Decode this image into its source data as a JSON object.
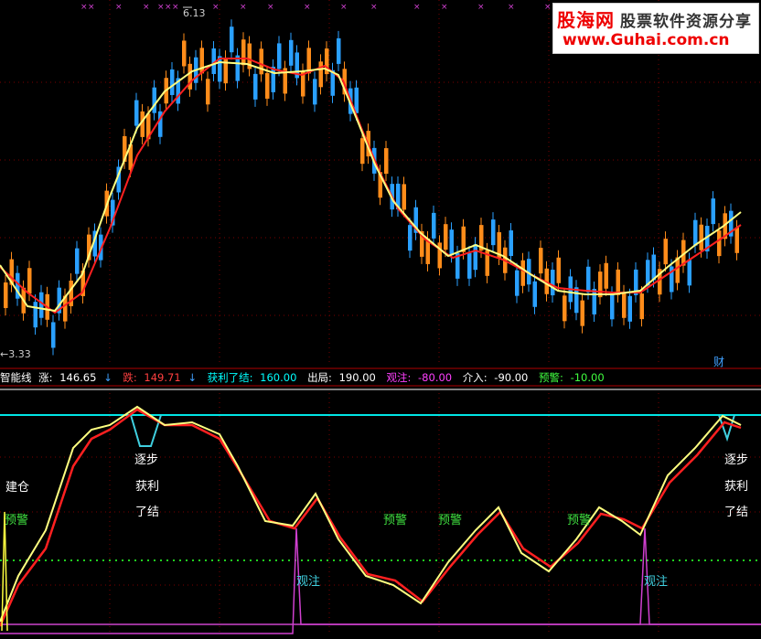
{
  "logo": {
    "brand": "股海网",
    "tagline": "股票软件资源分享",
    "url": "www.Guhai.com.cn"
  },
  "price_panel": {
    "high_marker": "6.13",
    "low_marker": "3.33",
    "event_marker": "财",
    "colors": {
      "up": "#ff8c1a",
      "down": "#2aa0ff",
      "ma_fast": "#ffff80",
      "ma_slow": "#ff2020",
      "grid": "#7a0000"
    }
  },
  "indicator_bar": {
    "name": "智能线",
    "items": [
      {
        "label": "涨:",
        "value": "146.65",
        "arrow": "↓",
        "color": "#ffffff"
      },
      {
        "label": "跌:",
        "value": "149.71",
        "arrow": "↓",
        "color": "#ff4040"
      },
      {
        "label": "获利了结:",
        "value": "160.00",
        "color": "#00ffff"
      },
      {
        "label": "出局:",
        "value": "190.00",
        "color": "#ffffff"
      },
      {
        "label": "观注:",
        "value": "-80.00",
        "color": "#ff40ff"
      },
      {
        "label": "介入:",
        "value": "-90.00",
        "color": "#ffffff"
      },
      {
        "label": "预警:",
        "value": "-10.00",
        "color": "#40ff40"
      }
    ]
  },
  "annotations": {
    "build_position": "建仓",
    "warning": "预警",
    "gradual": "逐步",
    "take_profit": "获利",
    "close_out": "了结",
    "watch": "观注"
  },
  "chart_data": [
    {
      "type": "candlestick",
      "title": "",
      "markers": {
        "high": 6.13,
        "low": 3.33
      },
      "series": [
        {
          "name": "",
          "type": "line",
          "role": "fast moving average"
        },
        {
          "name": "",
          "type": "line",
          "role": "slow moving average"
        }
      ]
    },
    {
      "type": "line",
      "title": "智能线",
      "series": [
        {
          "name": "涨",
          "value": 146.65
        },
        {
          "name": "跌",
          "value": 149.71
        },
        {
          "name": "获利了结",
          "value": 160.0
        },
        {
          "name": "出局",
          "value": 190.0
        },
        {
          "name": "观注",
          "value": -80.0
        },
        {
          "name": "介入",
          "value": -90.0
        },
        {
          "name": "预警",
          "value": -10.0
        }
      ]
    }
  ]
}
